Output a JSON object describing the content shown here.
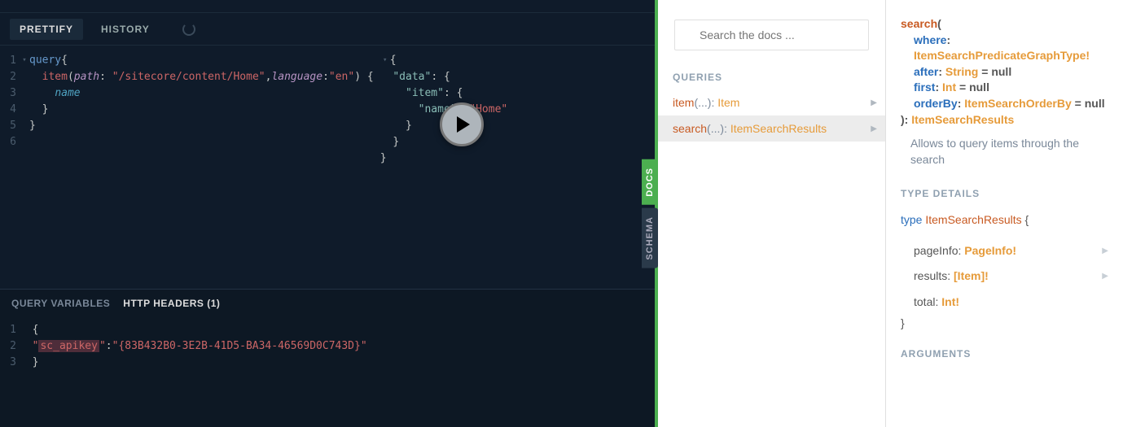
{
  "toolbar": {
    "prettify": "PRETTIFY",
    "history": "HISTORY"
  },
  "sidetabs": {
    "docs": "DOCS",
    "schema": "SCHEMA"
  },
  "query_editor": {
    "lines": [
      "1",
      "2",
      "3",
      "4",
      "5",
      "6"
    ],
    "kw_query": "query",
    "item": "item",
    "path_key": "path",
    "path_val": "\"/sitecore/content/Home\"",
    "lang_key": "language",
    "lang_val": "\"en\"",
    "field": "name"
  },
  "result_editor": {
    "data": "\"data\"",
    "item": "\"item\"",
    "name": "\"name\"",
    "home": "\"Home\""
  },
  "bottom": {
    "tab_vars": "QUERY VARIABLES",
    "tab_headers": "HTTP HEADERS (1)",
    "lines": [
      "1",
      "2",
      "3"
    ],
    "key": "sc_apikey",
    "val": "\"{83B432B0-3E2B-41D5-BA34-46569D0C743D}\""
  },
  "docs": {
    "search_placeholder": "Search the docs ...",
    "queries_label": "QUERIES",
    "rows": [
      {
        "name": "item",
        "args": "(...)",
        "sep": ": ",
        "type": "Item"
      },
      {
        "name": "search",
        "args": "(...)",
        "sep": ": ",
        "type": "ItemSearchResults"
      }
    ]
  },
  "details": {
    "fn": "search",
    "args": [
      {
        "name": "where",
        "type": "ItemSearchPredicateGraphType!",
        "default": null
      },
      {
        "name": "after",
        "type": "String",
        "default": "= null"
      },
      {
        "name": "first",
        "type": "Int",
        "default": "= null"
      },
      {
        "name": "orderBy",
        "type": "ItemSearchOrderBy",
        "default": "= null"
      }
    ],
    "return_type": "ItemSearchResults",
    "description": "Allows to query items through the search",
    "type_details_label": "TYPE DETAILS",
    "type_kw": "type",
    "type_name": "ItemSearchResults",
    "fields": [
      {
        "name": "pageInfo",
        "type": "PageInfo!"
      },
      {
        "name": "results",
        "type": "[Item]!"
      },
      {
        "name": "total",
        "type": "Int!"
      }
    ],
    "arguments_label": "ARGUMENTS"
  }
}
